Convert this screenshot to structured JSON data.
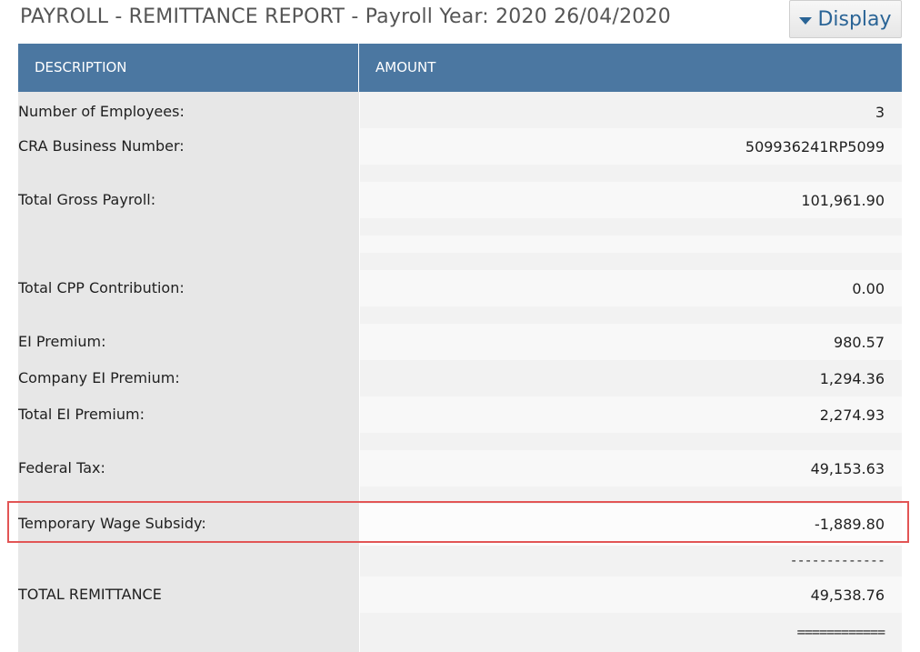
{
  "header": {
    "title": "PAYROLL - REMITTANCE REPORT - Payroll Year: 2020 26/04/2020",
    "display_label": "Display"
  },
  "table": {
    "columns": [
      "DESCRIPTION",
      "AMOUNT"
    ],
    "rows": [
      {
        "label": "Number of Employees:",
        "value": "3"
      },
      {
        "label": "CRA Business Number:",
        "value": "509936241RP5099"
      },
      {
        "label": "Total Gross Payroll:",
        "value": "101,961.90"
      },
      {
        "label": "Total CPP Contribution:",
        "value": "0.00"
      },
      {
        "label": "EI Premium:",
        "value": "980.57"
      },
      {
        "label": "Company EI Premium:",
        "value": "1,294.36"
      },
      {
        "label": "Total EI Premium:",
        "value": "2,274.93"
      },
      {
        "label": "Federal Tax:",
        "value": "49,153.63"
      },
      {
        "label": "Temporary Wage Subsidy:",
        "value": "-1,889.80"
      },
      {
        "label": "",
        "value": "-------------"
      },
      {
        "label": "TOTAL REMITTANCE",
        "value": "49,538.76"
      },
      {
        "label": "",
        "value": "============"
      }
    ]
  },
  "highlight_color": "#e25555",
  "header_color": "#4b77a1"
}
